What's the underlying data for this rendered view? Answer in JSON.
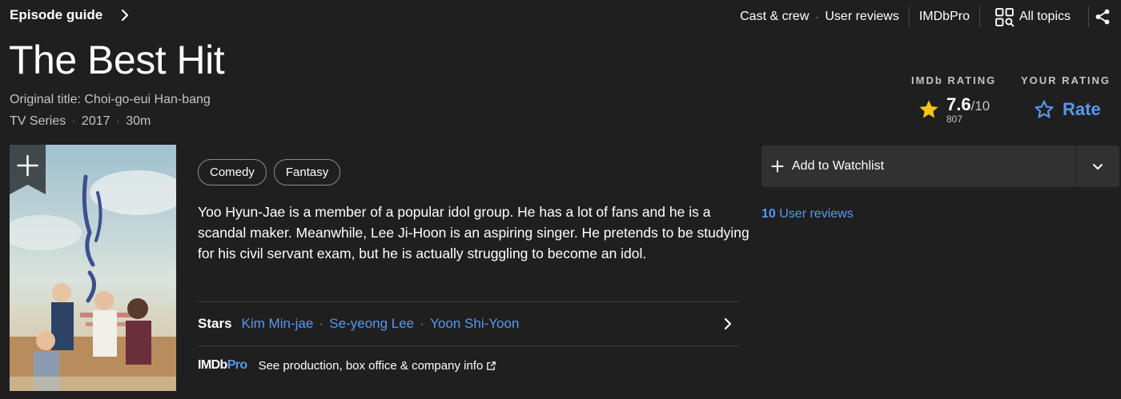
{
  "header": {
    "episode_guide": "Episode guide",
    "links": {
      "cast_crew": "Cast & crew",
      "separator": "·",
      "user_reviews": "User reviews",
      "imdbpro": "IMDbPro",
      "all_topics": "All topics"
    }
  },
  "title": {
    "name": "The Best Hit",
    "original_title": "Original title: Choi-go-eui Han-bang",
    "meta": [
      "TV Series",
      "2017",
      "30m"
    ],
    "meta_separator": "·"
  },
  "ratings": {
    "imdb_label": "IMDb RATING",
    "score": "7.6",
    "out_of": "/10",
    "count": "807",
    "your_label": "YOUR RATING",
    "rate_label": "Rate"
  },
  "genres": [
    "Comedy",
    "Fantasy"
  ],
  "plot": "Yoo Hyun-Jae is a member of a popular idol group. He has a lot of fans and he is a scandal maker. Meanwhile, Lee Ji-Hoon is an aspiring singer. He pretends to be studying for his civil servant exam, but he is actually struggling to become an idol.",
  "stars": {
    "label": "Stars",
    "names": [
      "Kim Min-jae",
      "Se-yeong Lee",
      "Yoon Shi-Yoon"
    ],
    "separator": "·"
  },
  "pro": {
    "logo_imdb": "IMDb",
    "logo_pro": "Pro",
    "text": "See production, box office & company info"
  },
  "watchlist": {
    "label": "Add to Watchlist"
  },
  "user_reviews": {
    "count": "10",
    "label": "User reviews"
  },
  "colors": {
    "background": "#1f1f1f",
    "accent_blue": "#5799ef",
    "star_yellow": "#f5c518",
    "button_bg": "#313131"
  },
  "icons": {
    "episode_chevron": "chevron-right-icon",
    "all_topics": "grid-search-icon",
    "share": "share-icon",
    "star": "star-filled-icon",
    "rate": "star-outline-icon",
    "poster_add": "plus-icon",
    "stars_chevron": "chevron-right-icon",
    "external": "external-link-icon",
    "watchlist_add": "plus-icon",
    "watchlist_dropdown": "chevron-down-icon"
  }
}
